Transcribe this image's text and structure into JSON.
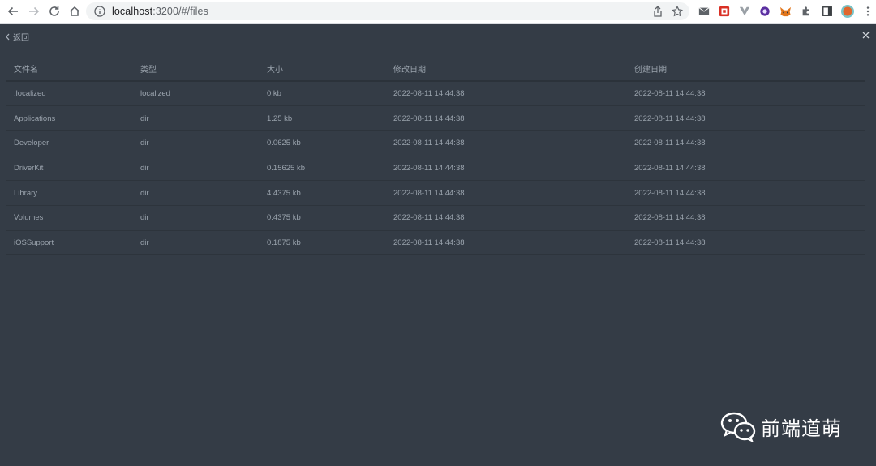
{
  "browser": {
    "url_host": "localhost",
    "url_rest": ":3200/#/files",
    "icons": [
      "back-arrow-icon",
      "forward-arrow-icon",
      "reload-icon",
      "home-icon",
      "info-icon",
      "share-icon",
      "star-icon",
      "mail-icon",
      "extension-icon",
      "vue-devtools-icon",
      "extension-purple-icon",
      "metamask-icon",
      "puzzle-icon",
      "sidebar-icon",
      "profile-avatar",
      "more-menu-icon"
    ]
  },
  "page": {
    "back_label": "返回",
    "close_icon": "close-icon"
  },
  "table": {
    "headers": [
      "文件名",
      "类型",
      "大小",
      "修改日期",
      "创建日期"
    ],
    "rows": [
      {
        "name": ".localized",
        "type": "localized",
        "size": "0 kb",
        "modified": "2022-08-11 14:44:38",
        "created": "2022-08-11 14:44:38"
      },
      {
        "name": "Applications",
        "type": "dir",
        "size": "1.25 kb",
        "modified": "2022-08-11 14:44:38",
        "created": "2022-08-11 14:44:38"
      },
      {
        "name": "Developer",
        "type": "dir",
        "size": "0.0625 kb",
        "modified": "2022-08-11 14:44:38",
        "created": "2022-08-11 14:44:38"
      },
      {
        "name": "DriverKit",
        "type": "dir",
        "size": "0.15625 kb",
        "modified": "2022-08-11 14:44:38",
        "created": "2022-08-11 14:44:38"
      },
      {
        "name": "Library",
        "type": "dir",
        "size": "4.4375 kb",
        "modified": "2022-08-11 14:44:38",
        "created": "2022-08-11 14:44:38"
      },
      {
        "name": "Volumes",
        "type": "dir",
        "size": "0.4375 kb",
        "modified": "2022-08-11 14:44:38",
        "created": "2022-08-11 14:44:38"
      },
      {
        "name": "iOSSupport",
        "type": "dir",
        "size": "0.1875 kb",
        "modified": "2022-08-11 14:44:38",
        "created": "2022-08-11 14:44:38"
      }
    ]
  },
  "watermark": {
    "text": "前端道萌",
    "icon": "wechat-icon"
  },
  "colors": {
    "background": "#343c46",
    "text": "#9aa3ad",
    "divider": "#2d343c"
  }
}
